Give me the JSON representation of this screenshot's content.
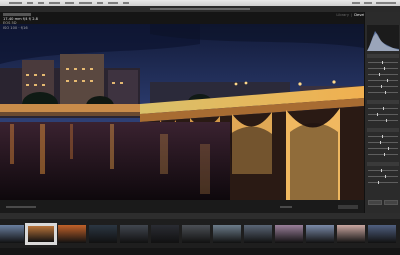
{
  "app": {
    "menus": [
      "Lightroom",
      "File",
      "Edit",
      "Library",
      "Photo",
      "Metadata",
      "View",
      "Window",
      "Help"
    ]
  },
  "header": {
    "modules": [
      {
        "label": "Library",
        "active": false
      },
      {
        "label": "Develop",
        "active": true
      },
      {
        "label": "Map",
        "active": false
      },
      {
        "label": "Book",
        "active": false
      }
    ]
  },
  "photo_info": {
    "lens": "17-40 mm f/4 f/ 2.8",
    "camera": "EOS 5D",
    "exposure": "ISO 100 · f/16"
  },
  "colors": {
    "accent": "#e8a94a",
    "sky_top": "#1d2a55",
    "water": "#1a0f16"
  },
  "filmstrip": {
    "selected_index": 1,
    "thumbs": [
      "#6a7fa0",
      "#b7733a",
      "#c2622a",
      "#2b3642",
      "#41464f",
      "#2a2c33",
      "#4b4f55",
      "#6c7c8a",
      "#5a6676",
      "#9a7f9a",
      "#7b8aa8",
      "#caa7a1",
      "#506080"
    ]
  }
}
